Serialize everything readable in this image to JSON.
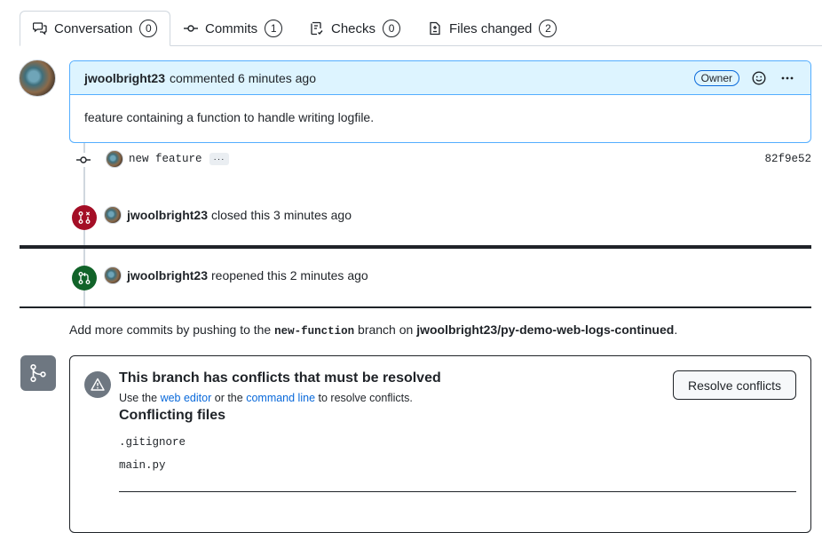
{
  "tabs": [
    {
      "label": "Conversation",
      "count": "0",
      "icon": "comment-discussion-icon"
    },
    {
      "label": "Commits",
      "count": "1",
      "icon": "git-commit-icon"
    },
    {
      "label": "Checks",
      "count": "0",
      "icon": "checklist-icon"
    },
    {
      "label": "Files changed",
      "count": "2",
      "icon": "file-diff-icon"
    }
  ],
  "comment": {
    "author": "jwoolbright23",
    "action": "commented 6 minutes ago",
    "badge": "Owner",
    "body": "feature containing a function to handle writing logfile."
  },
  "commit": {
    "message": "new feature",
    "ellipsis": "···",
    "sha": "82f9e52"
  },
  "events": [
    {
      "author": "jwoolbright23",
      "text": "closed this 3 minutes ago",
      "color": "#a40e26"
    },
    {
      "author": "jwoolbright23",
      "text": "reopened this 2 minutes ago",
      "color": "#116329"
    }
  ],
  "hint": {
    "prefix": "Add more commits by pushing to the",
    "branch": "new-function",
    "middle": "branch on",
    "repo": "jwoolbright23/py-demo-web-logs-continued",
    "suffix": "."
  },
  "merge": {
    "title": "This branch has conflicts that must be resolved",
    "use_text": "Use the",
    "web_editor": "web editor",
    "or_text": "or the",
    "command_line": "command line",
    "to_resolve": "to resolve conflicts.",
    "resolve_button": "Resolve conflicts",
    "conflicting_title": "Conflicting files",
    "files": [
      ".gitignore",
      "main.py"
    ]
  },
  "colors": {
    "accent": "#0969da",
    "closed": "#a40e26",
    "reopened": "#116329",
    "comment_header": "#ddf4ff"
  }
}
